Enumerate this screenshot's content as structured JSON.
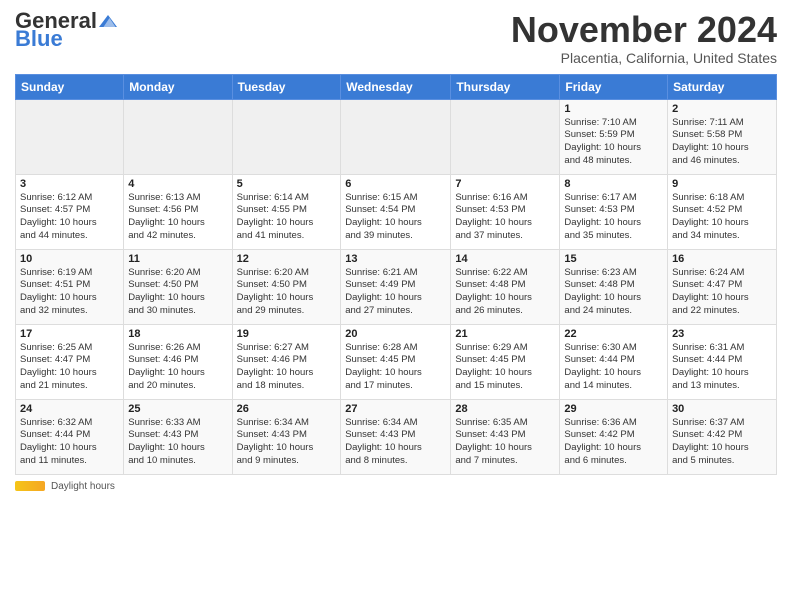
{
  "header": {
    "logo": {
      "general": "General",
      "blue": "Blue"
    },
    "title": "November 2024",
    "location": "Placentia, California, United States"
  },
  "calendar": {
    "days_of_week": [
      "Sunday",
      "Monday",
      "Tuesday",
      "Wednesday",
      "Thursday",
      "Friday",
      "Saturday"
    ],
    "weeks": [
      [
        {
          "day": "",
          "info": ""
        },
        {
          "day": "",
          "info": ""
        },
        {
          "day": "",
          "info": ""
        },
        {
          "day": "",
          "info": ""
        },
        {
          "day": "",
          "info": ""
        },
        {
          "day": "1",
          "info": "Sunrise: 7:10 AM\nSunset: 5:59 PM\nDaylight: 10 hours\nand 48 minutes."
        },
        {
          "day": "2",
          "info": "Sunrise: 7:11 AM\nSunset: 5:58 PM\nDaylight: 10 hours\nand 46 minutes."
        }
      ],
      [
        {
          "day": "3",
          "info": "Sunrise: 6:12 AM\nSunset: 4:57 PM\nDaylight: 10 hours\nand 44 minutes."
        },
        {
          "day": "4",
          "info": "Sunrise: 6:13 AM\nSunset: 4:56 PM\nDaylight: 10 hours\nand 42 minutes."
        },
        {
          "day": "5",
          "info": "Sunrise: 6:14 AM\nSunset: 4:55 PM\nDaylight: 10 hours\nand 41 minutes."
        },
        {
          "day": "6",
          "info": "Sunrise: 6:15 AM\nSunset: 4:54 PM\nDaylight: 10 hours\nand 39 minutes."
        },
        {
          "day": "7",
          "info": "Sunrise: 6:16 AM\nSunset: 4:53 PM\nDaylight: 10 hours\nand 37 minutes."
        },
        {
          "day": "8",
          "info": "Sunrise: 6:17 AM\nSunset: 4:53 PM\nDaylight: 10 hours\nand 35 minutes."
        },
        {
          "day": "9",
          "info": "Sunrise: 6:18 AM\nSunset: 4:52 PM\nDaylight: 10 hours\nand 34 minutes."
        }
      ],
      [
        {
          "day": "10",
          "info": "Sunrise: 6:19 AM\nSunset: 4:51 PM\nDaylight: 10 hours\nand 32 minutes."
        },
        {
          "day": "11",
          "info": "Sunrise: 6:20 AM\nSunset: 4:50 PM\nDaylight: 10 hours\nand 30 minutes."
        },
        {
          "day": "12",
          "info": "Sunrise: 6:20 AM\nSunset: 4:50 PM\nDaylight: 10 hours\nand 29 minutes."
        },
        {
          "day": "13",
          "info": "Sunrise: 6:21 AM\nSunset: 4:49 PM\nDaylight: 10 hours\nand 27 minutes."
        },
        {
          "day": "14",
          "info": "Sunrise: 6:22 AM\nSunset: 4:48 PM\nDaylight: 10 hours\nand 26 minutes."
        },
        {
          "day": "15",
          "info": "Sunrise: 6:23 AM\nSunset: 4:48 PM\nDaylight: 10 hours\nand 24 minutes."
        },
        {
          "day": "16",
          "info": "Sunrise: 6:24 AM\nSunset: 4:47 PM\nDaylight: 10 hours\nand 22 minutes."
        }
      ],
      [
        {
          "day": "17",
          "info": "Sunrise: 6:25 AM\nSunset: 4:47 PM\nDaylight: 10 hours\nand 21 minutes."
        },
        {
          "day": "18",
          "info": "Sunrise: 6:26 AM\nSunset: 4:46 PM\nDaylight: 10 hours\nand 20 minutes."
        },
        {
          "day": "19",
          "info": "Sunrise: 6:27 AM\nSunset: 4:46 PM\nDaylight: 10 hours\nand 18 minutes."
        },
        {
          "day": "20",
          "info": "Sunrise: 6:28 AM\nSunset: 4:45 PM\nDaylight: 10 hours\nand 17 minutes."
        },
        {
          "day": "21",
          "info": "Sunrise: 6:29 AM\nSunset: 4:45 PM\nDaylight: 10 hours\nand 15 minutes."
        },
        {
          "day": "22",
          "info": "Sunrise: 6:30 AM\nSunset: 4:44 PM\nDaylight: 10 hours\nand 14 minutes."
        },
        {
          "day": "23",
          "info": "Sunrise: 6:31 AM\nSunset: 4:44 PM\nDaylight: 10 hours\nand 13 minutes."
        }
      ],
      [
        {
          "day": "24",
          "info": "Sunrise: 6:32 AM\nSunset: 4:44 PM\nDaylight: 10 hours\nand 11 minutes."
        },
        {
          "day": "25",
          "info": "Sunrise: 6:33 AM\nSunset: 4:43 PM\nDaylight: 10 hours\nand 10 minutes."
        },
        {
          "day": "26",
          "info": "Sunrise: 6:34 AM\nSunset: 4:43 PM\nDaylight: 10 hours\nand 9 minutes."
        },
        {
          "day": "27",
          "info": "Sunrise: 6:34 AM\nSunset: 4:43 PM\nDaylight: 10 hours\nand 8 minutes."
        },
        {
          "day": "28",
          "info": "Sunrise: 6:35 AM\nSunset: 4:43 PM\nDaylight: 10 hours\nand 7 minutes."
        },
        {
          "day": "29",
          "info": "Sunrise: 6:36 AM\nSunset: 4:42 PM\nDaylight: 10 hours\nand 6 minutes."
        },
        {
          "day": "30",
          "info": "Sunrise: 6:37 AM\nSunset: 4:42 PM\nDaylight: 10 hours\nand 5 minutes."
        }
      ]
    ]
  },
  "footer": {
    "daylight_label": "Daylight hours"
  }
}
